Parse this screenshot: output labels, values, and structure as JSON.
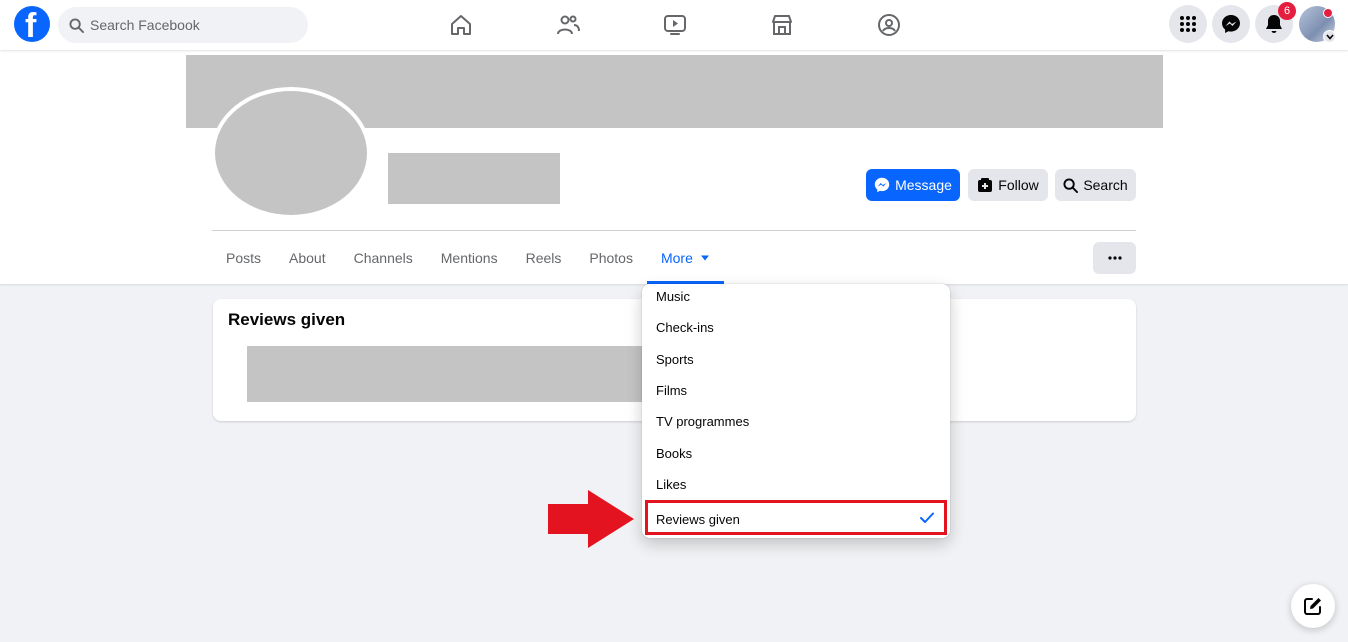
{
  "header": {
    "search_placeholder": "Search Facebook",
    "notification_count": "6"
  },
  "profile": {
    "message_label": "Message",
    "follow_label": "Follow",
    "search_label": "Search"
  },
  "tabs": [
    {
      "label": "Posts"
    },
    {
      "label": "About"
    },
    {
      "label": "Channels"
    },
    {
      "label": "Mentions"
    },
    {
      "label": "Reels"
    },
    {
      "label": "Photos"
    },
    {
      "label": "More"
    }
  ],
  "section": {
    "title": "Reviews given"
  },
  "more_menu": {
    "items": [
      "Music",
      "Check-ins",
      "Sports",
      "Films",
      "TV programmes",
      "Books",
      "Likes"
    ],
    "selected": "Reviews given"
  },
  "colors": {
    "brand": "#0866ff",
    "highlight": "#e3141f",
    "arrow": "#e3141f"
  }
}
